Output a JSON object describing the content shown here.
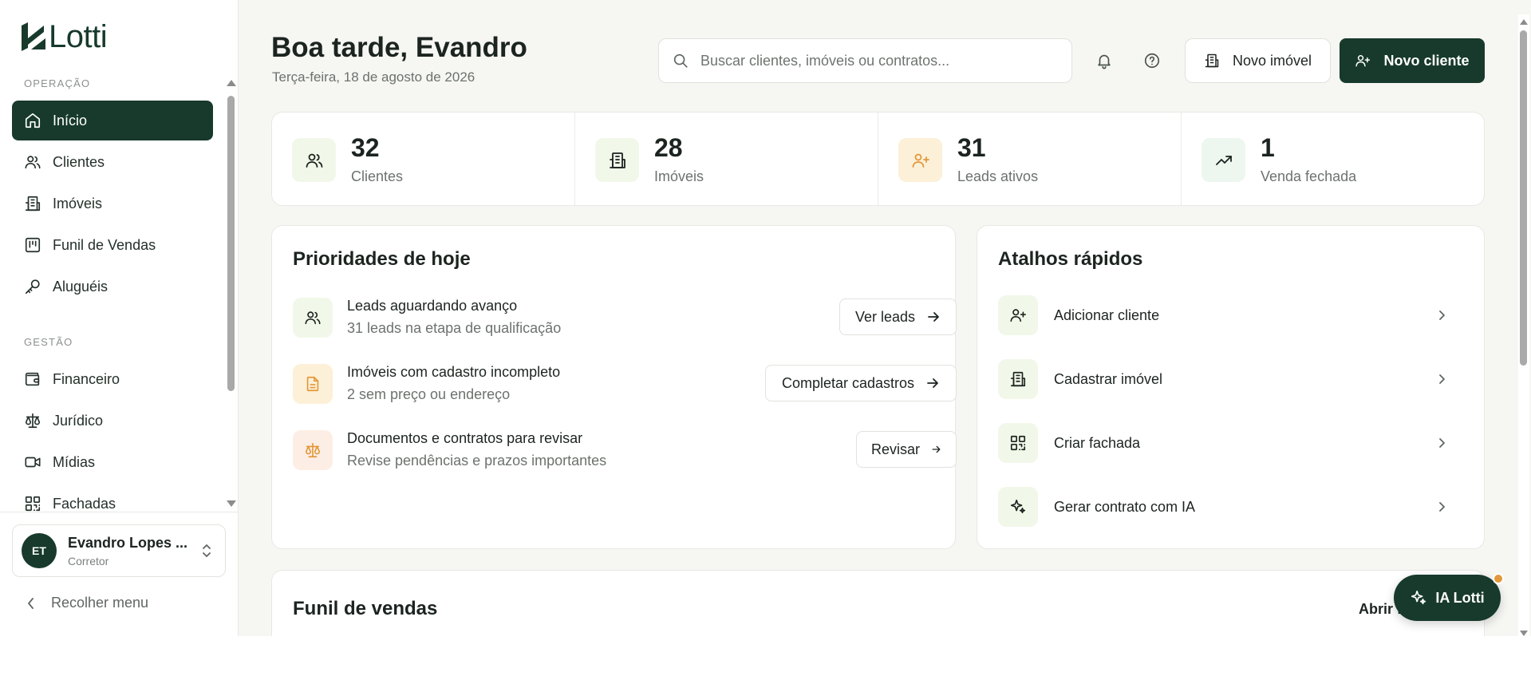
{
  "brand": {
    "name": "Lotti"
  },
  "colors": {
    "primary": "#173a2c",
    "background": "#f6f6f3",
    "accent_orange": "#e2983a"
  },
  "sidebar": {
    "sections": [
      {
        "label": "OPERAÇÃO",
        "items": [
          {
            "label": "Início",
            "icon": "home-icon",
            "active": true
          },
          {
            "label": "Clientes",
            "icon": "users-icon"
          },
          {
            "label": "Imóveis",
            "icon": "building-icon"
          },
          {
            "label": "Funil de Vendas",
            "icon": "kanban-icon"
          },
          {
            "label": "Aluguéis",
            "icon": "key-icon"
          }
        ]
      },
      {
        "label": "GESTÃO",
        "items": [
          {
            "label": "Financeiro",
            "icon": "wallet-icon"
          },
          {
            "label": "Jurídico",
            "icon": "scale-icon"
          },
          {
            "label": "Mídias",
            "icon": "video-icon"
          },
          {
            "label": "Fachadas",
            "icon": "qrcode-icon"
          }
        ]
      }
    ],
    "user": {
      "initials": "ET",
      "name": "Evandro Lopes ...",
      "role": "Corretor"
    },
    "collapse_label": "Recolher menu"
  },
  "header": {
    "greeting": "Boa tarde, Evandro",
    "date": "Terça-feira, 18 de agosto de 2026",
    "search_placeholder": "Buscar clientes, imóveis ou contratos...",
    "new_property_label": "Novo imóvel",
    "new_client_label": "Novo cliente"
  },
  "stats": [
    {
      "value": "32",
      "label": "Clientes",
      "icon": "users-icon",
      "bg": "#f1f8e9"
    },
    {
      "value": "28",
      "label": "Imóveis",
      "icon": "building-icon",
      "bg": "#f1f8e9"
    },
    {
      "value": "31",
      "label": "Leads ativos",
      "icon": "user-plus-icon",
      "bg": "#fdf0d8"
    },
    {
      "value": "1",
      "label": "Venda fechada",
      "icon": "trending-up-icon",
      "bg": "#eef6f0"
    }
  ],
  "priorities": {
    "title": "Prioridades de hoje",
    "items": [
      {
        "title": "Leads aguardando avanço",
        "subtitle": "31 leads na etapa de qualificação",
        "button": "Ver leads",
        "icon": "users-icon",
        "bg": "#f1f8e9"
      },
      {
        "title": "Imóveis com cadastro incompleto",
        "subtitle": "2 sem preço ou endereço",
        "button": "Completar cadastros",
        "icon": "document-icon",
        "bg": "#fdf0d8"
      },
      {
        "title": "Documentos e contratos para revisar",
        "subtitle": "Revise pendências e prazos importantes",
        "button": "Revisar",
        "icon": "scale-icon",
        "bg": "#fdeee5"
      }
    ]
  },
  "shortcuts": {
    "title": "Atalhos rápidos",
    "items": [
      {
        "label": "Adicionar cliente",
        "icon": "user-plus-icon"
      },
      {
        "label": "Cadastrar imóvel",
        "icon": "building-icon"
      },
      {
        "label": "Criar fachada",
        "icon": "qrcode-icon"
      },
      {
        "label": "Gerar contrato com IA",
        "icon": "sparkles-icon"
      }
    ]
  },
  "funnel": {
    "title": "Funil de vendas",
    "link_label": "Abrir f"
  },
  "ia_button": {
    "label": "IA Lotti"
  }
}
